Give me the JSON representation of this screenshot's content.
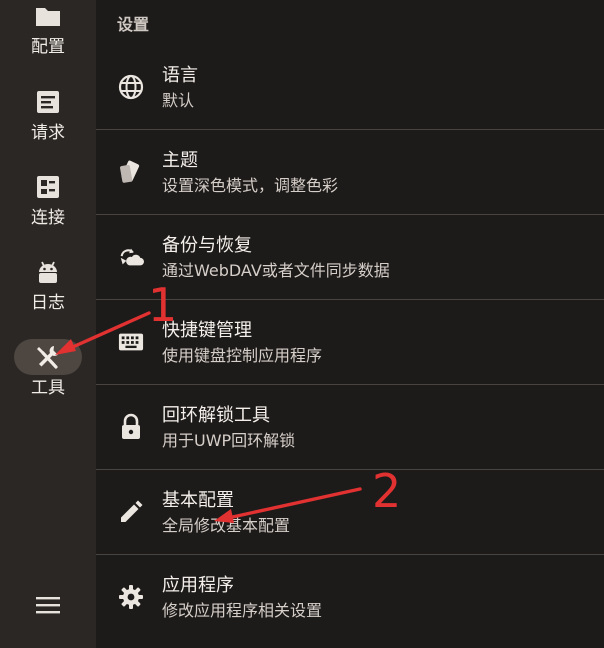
{
  "sidebar": {
    "items": [
      {
        "label": "配置",
        "icon": "folder-icon"
      },
      {
        "label": "请求",
        "icon": "document-icon"
      },
      {
        "label": "连接",
        "icon": "grid-icon"
      },
      {
        "label": "日志",
        "icon": "android-icon"
      },
      {
        "label": "工具",
        "icon": "tools-icon",
        "active": true
      }
    ],
    "menu_icon": "hamburger-menu-icon"
  },
  "main": {
    "section_title": "设置",
    "items": [
      {
        "title": "语言",
        "subtitle": "默认",
        "icon": "globe-icon"
      },
      {
        "title": "主题",
        "subtitle": "设置深色模式，调整色彩",
        "icon": "palette-cards-icon"
      },
      {
        "title": "备份与恢复",
        "subtitle": "通过WebDAV或者文件同步数据",
        "icon": "cloud-sync-icon"
      },
      {
        "title": "快捷键管理",
        "subtitle": "使用键盘控制应用程序",
        "icon": "keyboard-icon"
      },
      {
        "title": "回环解锁工具",
        "subtitle": "用于UWP回环解锁",
        "icon": "lock-icon"
      },
      {
        "title": "基本配置",
        "subtitle": "全局修改基本配置",
        "icon": "pencil-icon"
      },
      {
        "title": "应用程序",
        "subtitle": "修改应用程序相关设置",
        "icon": "gear-icon"
      }
    ]
  },
  "annotations": {
    "marker_1": "1",
    "marker_2": "2",
    "color": "#e23131"
  },
  "colors": {
    "sidebar_bg": "#2a2725",
    "main_bg": "#1c1b1a",
    "active_pill": "#4e4640",
    "text": "#f4efea"
  }
}
